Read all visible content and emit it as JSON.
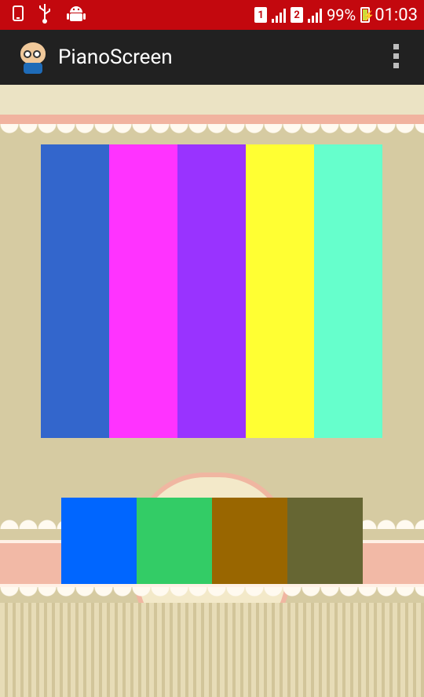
{
  "status_bar": {
    "sim1": "1",
    "sim2": "2",
    "battery": "99%",
    "time": "01:03",
    "icons": [
      "phone-icon",
      "usb-icon",
      "android-icon"
    ]
  },
  "action_bar": {
    "title": "PianoScreen",
    "menu_icon": "overflow-menu-icon"
  },
  "piano_top_keys": [
    {
      "name": "key-blue",
      "color": "#3366cc"
    },
    {
      "name": "key-magenta",
      "color": "#ff33ff"
    },
    {
      "name": "key-purple",
      "color": "#9933ff"
    },
    {
      "name": "key-yellow",
      "color": "#ffff33"
    },
    {
      "name": "key-aqua",
      "color": "#66ffcc"
    }
  ],
  "piano_bottom_keys": [
    {
      "name": "key-bright-blue",
      "color": "#0066ff"
    },
    {
      "name": "key-green",
      "color": "#33cc66"
    },
    {
      "name": "key-brown",
      "color": "#996600"
    },
    {
      "name": "key-olive",
      "color": "#666633"
    }
  ]
}
